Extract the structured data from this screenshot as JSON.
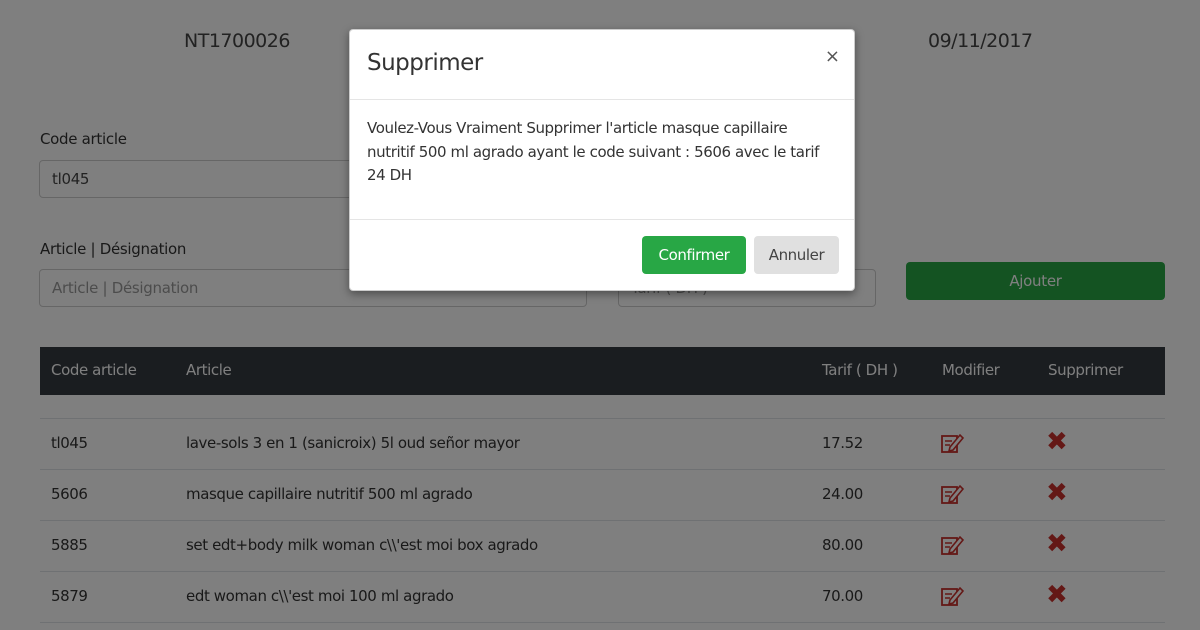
{
  "header": {
    "reference": "NT1700026",
    "date": "09/11/2017"
  },
  "form": {
    "code_label": "Code article",
    "code_value": "tl045",
    "designation_label": "Article | Désignation",
    "designation_placeholder": "Article | Désignation",
    "tarif_placeholder": "Tarif ( DH )",
    "add_button": "Ajouter"
  },
  "table": {
    "headers": [
      "Code article",
      "Article",
      "Tarif ( DH )",
      "Modifier",
      "Supprimer"
    ],
    "rows": [
      {
        "code": "tl045",
        "article": "lave-sols 3 en 1 (sanicroix) 5l oud señor mayor",
        "tarif": "17.52"
      },
      {
        "code": "5606",
        "article": "masque capillaire nutritif 500 ml agrado",
        "tarif": "24.00"
      },
      {
        "code": "5885",
        "article": "set edt+body milk woman c\\\\'est moi box agrado",
        "tarif": "80.00"
      },
      {
        "code": "5879",
        "article": "edt woman c\\\\'est moi 100 ml agrado",
        "tarif": "70.00"
      }
    ],
    "edit_icon": "edit-icon",
    "delete_icon": "delete-x-icon"
  },
  "modal": {
    "title": "Supprimer",
    "close": "×",
    "message": "Voulez-Vous Vraiment Supprimer l'article masque capillaire nutritif 500 ml agrado ayant le code suivant : 5606 avec le tarif 24 DH",
    "confirm": "Confirmer",
    "cancel": "Annuler"
  },
  "colors": {
    "primary_green": "#28a745",
    "table_header": "#343a40",
    "delete_red": "#c9302c",
    "edit_red": "#c9302c"
  }
}
